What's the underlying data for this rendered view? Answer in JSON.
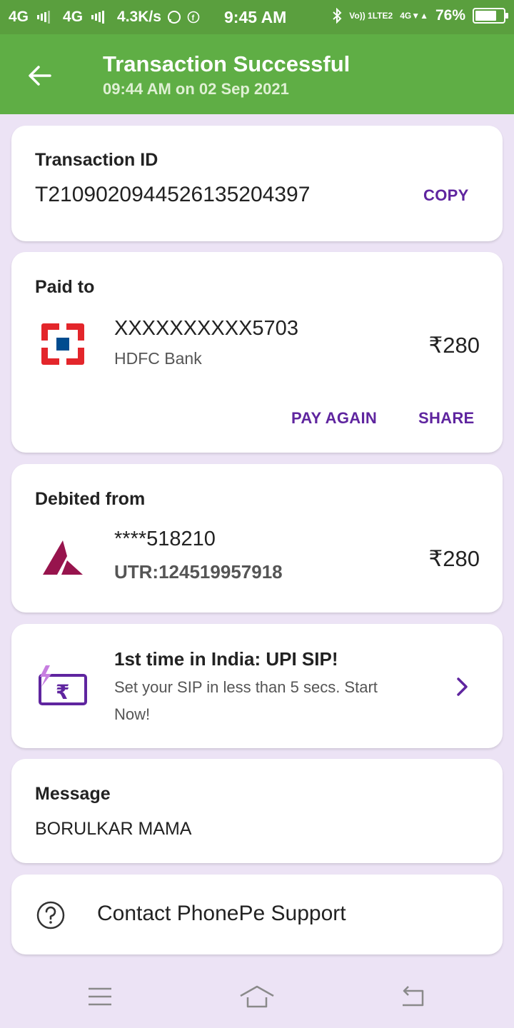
{
  "status_bar": {
    "network1": "4G",
    "network2": "4G",
    "speed": "4.3K/s",
    "time": "9:45 AM",
    "volte_top": "Vo)) 1",
    "volte_bottom": "LTE2",
    "net3": "4G",
    "battery": "76%",
    "battery_level": 0.76
  },
  "header": {
    "title": "Transaction Successful",
    "subtitle": "09:44 AM on 02 Sep 2021",
    "background": "#5fae45"
  },
  "transaction": {
    "label": "Transaction ID",
    "id": "T2109020944526135204397",
    "copy_label": "COPY"
  },
  "paid_to": {
    "label": "Paid to",
    "account": "XXXXXXXXXX5703",
    "bank": "HDFC Bank",
    "amount": "₹280",
    "pay_again_label": "PAY AGAIN",
    "share_label": "SHARE",
    "bank_icon": "hdfc-logo-icon"
  },
  "debited_from": {
    "label": "Debited from",
    "account": "****518210",
    "utr": "UTR:124519957918",
    "amount": "₹280",
    "bank_icon": "axis-logo-icon"
  },
  "promo": {
    "title": "1st time in India: UPI SIP!",
    "line1": "Set your SIP in less than 5 secs. Start",
    "line2": "Now!",
    "icon": "sip-rupee-icon"
  },
  "message": {
    "label": "Message",
    "text": "BORULKAR MAMA"
  },
  "support": {
    "label": "Contact PhonePe Support",
    "icon": "help-circle-icon"
  },
  "accent_color": "#5f259f"
}
